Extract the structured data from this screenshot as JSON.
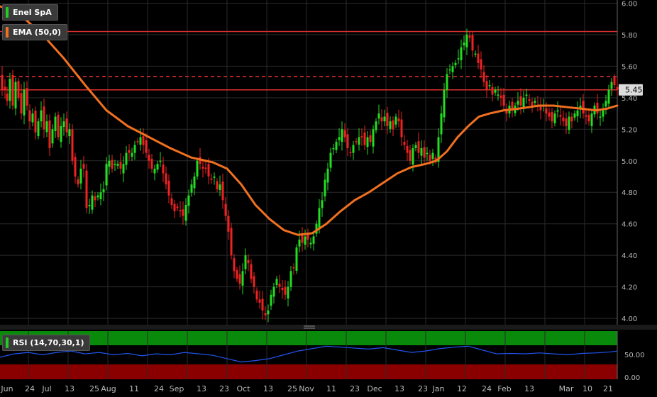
{
  "chart_data": [
    {
      "type": "candlestick",
      "legend": [
        {
          "label": "Enel SpA",
          "color": "#22cc22"
        },
        {
          "label": "EMA (50,0)",
          "color": "#f07020"
        }
      ],
      "y_ticks": [
        "6.00",
        "5.80",
        "5.60",
        "5.40",
        "5.20",
        "5.00",
        "4.80",
        "4.60",
        "4.40",
        "4.20",
        "4.00"
      ],
      "y_tick_values": [
        6.0,
        5.8,
        5.6,
        5.4,
        5.2,
        5.0,
        4.8,
        4.6,
        4.4,
        4.2,
        4.0
      ],
      "ylim": [
        3.96,
        6.02
      ],
      "current_price_label": "5.45",
      "current_price": 5.45,
      "horizontal_lines": [
        {
          "value": 5.82,
          "style": "solid",
          "color": "#e03030"
        },
        {
          "value": 5.535,
          "style": "dashed",
          "color": "#e03030"
        },
        {
          "value": 5.45,
          "style": "solid",
          "color": "#e03030"
        }
      ],
      "x_tick_labels": [
        "Jun",
        "24",
        "Jul",
        "13",
        "25",
        "Aug",
        "11",
        "24",
        "Sep",
        "13",
        "23",
        "Oct",
        "13",
        "25",
        "Nov",
        "11",
        "23",
        "Dec",
        "13",
        "23",
        "Jan",
        "12",
        "24",
        "Feb",
        "13",
        "Mar",
        "10",
        "21"
      ],
      "close_path": [
        [
          0,
          5.55
        ],
        [
          3,
          5.45
        ],
        [
          7,
          5.45
        ],
        [
          10,
          5.38
        ],
        [
          14,
          5.52
        ],
        [
          18,
          5.35
        ],
        [
          22,
          5.5
        ],
        [
          26,
          5.4
        ],
        [
          30,
          5.3
        ],
        [
          34,
          5.45
        ],
        [
          38,
          5.35
        ],
        [
          42,
          5.25
        ],
        [
          46,
          5.3
        ],
        [
          50,
          5.18
        ],
        [
          54,
          5.25
        ],
        [
          58,
          5.32
        ],
        [
          62,
          5.2
        ],
        [
          66,
          5.25
        ],
        [
          70,
          5.08
        ],
        [
          74,
          5.2
        ],
        [
          78,
          5.28
        ],
        [
          82,
          5.15
        ],
        [
          86,
          5.22
        ],
        [
          90,
          5.25
        ],
        [
          94,
          5.18
        ],
        [
          98,
          5.2
        ],
        [
          102,
          5.0
        ],
        [
          106,
          4.9
        ],
        [
          110,
          4.85
        ],
        [
          114,
          4.95
        ],
        [
          118,
          4.95
        ],
        [
          122,
          4.7
        ],
        [
          126,
          4.72
        ],
        [
          130,
          4.78
        ],
        [
          134,
          4.75
        ],
        [
          138,
          4.78
        ],
        [
          142,
          4.8
        ],
        [
          146,
          4.82
        ],
        [
          150,
          4.98
        ],
        [
          154,
          5.0
        ],
        [
          158,
          4.95
        ],
        [
          162,
          4.98
        ],
        [
          166,
          4.98
        ],
        [
          170,
          4.95
        ],
        [
          174,
          4.98
        ],
        [
          178,
          5.05
        ],
        [
          182,
          5.05
        ],
        [
          186,
          5.05
        ],
        [
          190,
          5.1
        ],
        [
          194,
          5.12
        ],
        [
          198,
          5.15
        ],
        [
          202,
          5.1
        ],
        [
          206,
          5.05
        ],
        [
          210,
          5.0
        ],
        [
          214,
          4.95
        ],
        [
          218,
          4.95
        ],
        [
          222,
          4.98
        ],
        [
          226,
          5.0
        ],
        [
          230,
          4.92
        ],
        [
          234,
          4.85
        ],
        [
          238,
          4.78
        ],
        [
          242,
          4.72
        ],
        [
          246,
          4.68
        ],
        [
          250,
          4.7
        ],
        [
          254,
          4.68
        ],
        [
          258,
          4.65
        ],
        [
          262,
          4.72
        ],
        [
          266,
          4.78
        ],
        [
          270,
          4.85
        ],
        [
          274,
          4.9
        ],
        [
          278,
          5.0
        ],
        [
          282,
          4.98
        ],
        [
          286,
          4.95
        ],
        [
          290,
          4.95
        ],
        [
          294,
          4.9
        ],
        [
          298,
          4.88
        ],
        [
          302,
          4.9
        ],
        [
          306,
          4.82
        ],
        [
          310,
          4.85
        ],
        [
          314,
          4.75
        ],
        [
          318,
          4.65
        ],
        [
          322,
          4.55
        ],
        [
          326,
          4.4
        ],
        [
          330,
          4.3
        ],
        [
          334,
          4.25
        ],
        [
          338,
          4.22
        ],
        [
          342,
          4.3
        ],
        [
          346,
          4.4
        ],
        [
          350,
          4.35
        ],
        [
          354,
          4.25
        ],
        [
          358,
          4.2
        ],
        [
          362,
          4.12
        ],
        [
          366,
          4.1
        ],
        [
          370,
          4.05
        ],
        [
          374,
          4.02
        ],
        [
          378,
          4.05
        ],
        [
          382,
          4.15
        ],
        [
          386,
          4.2
        ],
        [
          390,
          4.25
        ],
        [
          394,
          4.2
        ],
        [
          398,
          4.18
        ],
        [
          402,
          4.15
        ],
        [
          406,
          4.2
        ],
        [
          410,
          4.3
        ],
        [
          414,
          4.32
        ],
        [
          418,
          4.45
        ],
        [
          422,
          4.5
        ],
        [
          426,
          4.48
        ],
        [
          430,
          4.52
        ],
        [
          434,
          4.5
        ],
        [
          438,
          4.48
        ],
        [
          442,
          4.52
        ],
        [
          446,
          4.6
        ],
        [
          450,
          4.7
        ],
        [
          454,
          4.75
        ],
        [
          458,
          4.88
        ],
        [
          462,
          4.95
        ],
        [
          466,
          5.05
        ],
        [
          470,
          5.08
        ],
        [
          474,
          5.12
        ],
        [
          478,
          5.15
        ],
        [
          482,
          5.2
        ],
        [
          486,
          5.15
        ],
        [
          490,
          5.08
        ],
        [
          494,
          5.05
        ],
        [
          498,
          5.1
        ],
        [
          502,
          5.12
        ],
        [
          506,
          5.15
        ],
        [
          510,
          5.15
        ],
        [
          514,
          5.1
        ],
        [
          518,
          5.15
        ],
        [
          522,
          5.12
        ],
        [
          526,
          5.2
        ],
        [
          530,
          5.25
        ],
        [
          534,
          5.3
        ],
        [
          538,
          5.25
        ],
        [
          542,
          5.28
        ],
        [
          546,
          5.22
        ],
        [
          550,
          5.25
        ],
        [
          554,
          5.2
        ],
        [
          558,
          5.28
        ],
        [
          562,
          5.25
        ],
        [
          566,
          5.15
        ],
        [
          570,
          5.1
        ],
        [
          574,
          5.05
        ],
        [
          578,
          5.0
        ],
        [
          582,
          5.08
        ],
        [
          586,
          5.1
        ],
        [
          590,
          5.05
        ],
        [
          594,
          5.08
        ],
        [
          598,
          5.02
        ],
        [
          602,
          5.05
        ],
        [
          606,
          5.0
        ],
        [
          610,
          5.05
        ],
        [
          614,
          5.0
        ],
        [
          618,
          5.15
        ],
        [
          622,
          5.3
        ],
        [
          626,
          5.45
        ],
        [
          630,
          5.55
        ],
        [
          634,
          5.58
        ],
        [
          638,
          5.6
        ],
        [
          642,
          5.62
        ],
        [
          646,
          5.65
        ],
        [
          650,
          5.72
        ],
        [
          654,
          5.75
        ],
        [
          658,
          5.8
        ],
        [
          662,
          5.78
        ],
        [
          666,
          5.7
        ],
        [
          670,
          5.68
        ],
        [
          674,
          5.62
        ],
        [
          678,
          5.58
        ],
        [
          682,
          5.5
        ],
        [
          686,
          5.45
        ],
        [
          690,
          5.48
        ],
        [
          694,
          5.42
        ],
        [
          698,
          5.45
        ],
        [
          702,
          5.42
        ],
        [
          706,
          5.4
        ],
        [
          710,
          5.35
        ],
        [
          714,
          5.3
        ],
        [
          718,
          5.35
        ],
        [
          722,
          5.32
        ],
        [
          726,
          5.35
        ],
        [
          730,
          5.38
        ],
        [
          734,
          5.35
        ],
        [
          738,
          5.4
        ],
        [
          742,
          5.42
        ],
        [
          746,
          5.38
        ],
        [
          750,
          5.35
        ],
        [
          754,
          5.38
        ],
        [
          758,
          5.35
        ],
        [
          762,
          5.32
        ],
        [
          766,
          5.35
        ],
        [
          770,
          5.3
        ],
        [
          774,
          5.28
        ],
        [
          778,
          5.25
        ],
        [
          782,
          5.3
        ],
        [
          786,
          5.32
        ],
        [
          790,
          5.28
        ],
        [
          794,
          5.25
        ],
        [
          798,
          5.22
        ],
        [
          802,
          5.28
        ],
        [
          806,
          5.25
        ],
        [
          810,
          5.3
        ],
        [
          814,
          5.32
        ],
        [
          818,
          5.35
        ],
        [
          822,
          5.3
        ],
        [
          826,
          5.28
        ],
        [
          830,
          5.25
        ],
        [
          834,
          5.3
        ],
        [
          838,
          5.35
        ],
        [
          842,
          5.3
        ],
        [
          846,
          5.28
        ],
        [
          850,
          5.32
        ],
        [
          854,
          5.38
        ],
        [
          858,
          5.45
        ],
        [
          862,
          5.5
        ],
        [
          866,
          5.48
        ],
        [
          870,
          5.45
        ]
      ],
      "ema_path": [
        [
          0,
          5.98
        ],
        [
          30,
          5.92
        ],
        [
          60,
          5.8
        ],
        [
          90,
          5.65
        ],
        [
          120,
          5.48
        ],
        [
          150,
          5.32
        ],
        [
          180,
          5.22
        ],
        [
          210,
          5.15
        ],
        [
          240,
          5.08
        ],
        [
          270,
          5.02
        ],
        [
          300,
          4.99
        ],
        [
          320,
          4.95
        ],
        [
          340,
          4.85
        ],
        [
          360,
          4.72
        ],
        [
          380,
          4.63
        ],
        [
          400,
          4.56
        ],
        [
          420,
          4.53
        ],
        [
          440,
          4.54
        ],
        [
          460,
          4.6
        ],
        [
          480,
          4.68
        ],
        [
          500,
          4.75
        ],
        [
          520,
          4.8
        ],
        [
          540,
          4.86
        ],
        [
          560,
          4.92
        ],
        [
          580,
          4.96
        ],
        [
          600,
          4.98
        ],
        [
          615,
          5.0
        ],
        [
          630,
          5.06
        ],
        [
          645,
          5.15
        ],
        [
          660,
          5.22
        ],
        [
          675,
          5.28
        ],
        [
          690,
          5.3
        ],
        [
          710,
          5.32
        ],
        [
          730,
          5.33
        ],
        [
          760,
          5.35
        ],
        [
          780,
          5.35
        ],
        [
          800,
          5.34
        ],
        [
          820,
          5.33
        ],
        [
          840,
          5.32
        ],
        [
          855,
          5.33
        ],
        [
          870,
          5.35
        ]
      ]
    },
    {
      "type": "line",
      "legend": [
        {
          "label": "RSI (14,70,30,1)",
          "color": "#22cc22"
        }
      ],
      "y_ticks": [
        "50.00",
        "0.00"
      ],
      "y_tick_values": [
        50,
        0
      ],
      "ylim": [
        0,
        100
      ],
      "overbought": 70,
      "oversold": 30,
      "rsi_path": [
        [
          0,
          45
        ],
        [
          20,
          52
        ],
        [
          40,
          55
        ],
        [
          60,
          50
        ],
        [
          80,
          55
        ],
        [
          100,
          58
        ],
        [
          120,
          52
        ],
        [
          140,
          55
        ],
        [
          160,
          50
        ],
        [
          180,
          53
        ],
        [
          200,
          48
        ],
        [
          220,
          52
        ],
        [
          240,
          50
        ],
        [
          260,
          55
        ],
        [
          280,
          52
        ],
        [
          300,
          49
        ],
        [
          320,
          42
        ],
        [
          340,
          35
        ],
        [
          360,
          38
        ],
        [
          380,
          42
        ],
        [
          400,
          50
        ],
        [
          420,
          58
        ],
        [
          440,
          63
        ],
        [
          460,
          68
        ],
        [
          480,
          66
        ],
        [
          500,
          64
        ],
        [
          520,
          62
        ],
        [
          540,
          65
        ],
        [
          560,
          60
        ],
        [
          580,
          55
        ],
        [
          600,
          58
        ],
        [
          620,
          63
        ],
        [
          640,
          66
        ],
        [
          660,
          68
        ],
        [
          680,
          60
        ],
        [
          700,
          52
        ],
        [
          720,
          53
        ],
        [
          740,
          52
        ],
        [
          760,
          54
        ],
        [
          780,
          52
        ],
        [
          800,
          50
        ],
        [
          820,
          53
        ],
        [
          840,
          54
        ],
        [
          860,
          56
        ],
        [
          870,
          58
        ]
      ]
    }
  ]
}
